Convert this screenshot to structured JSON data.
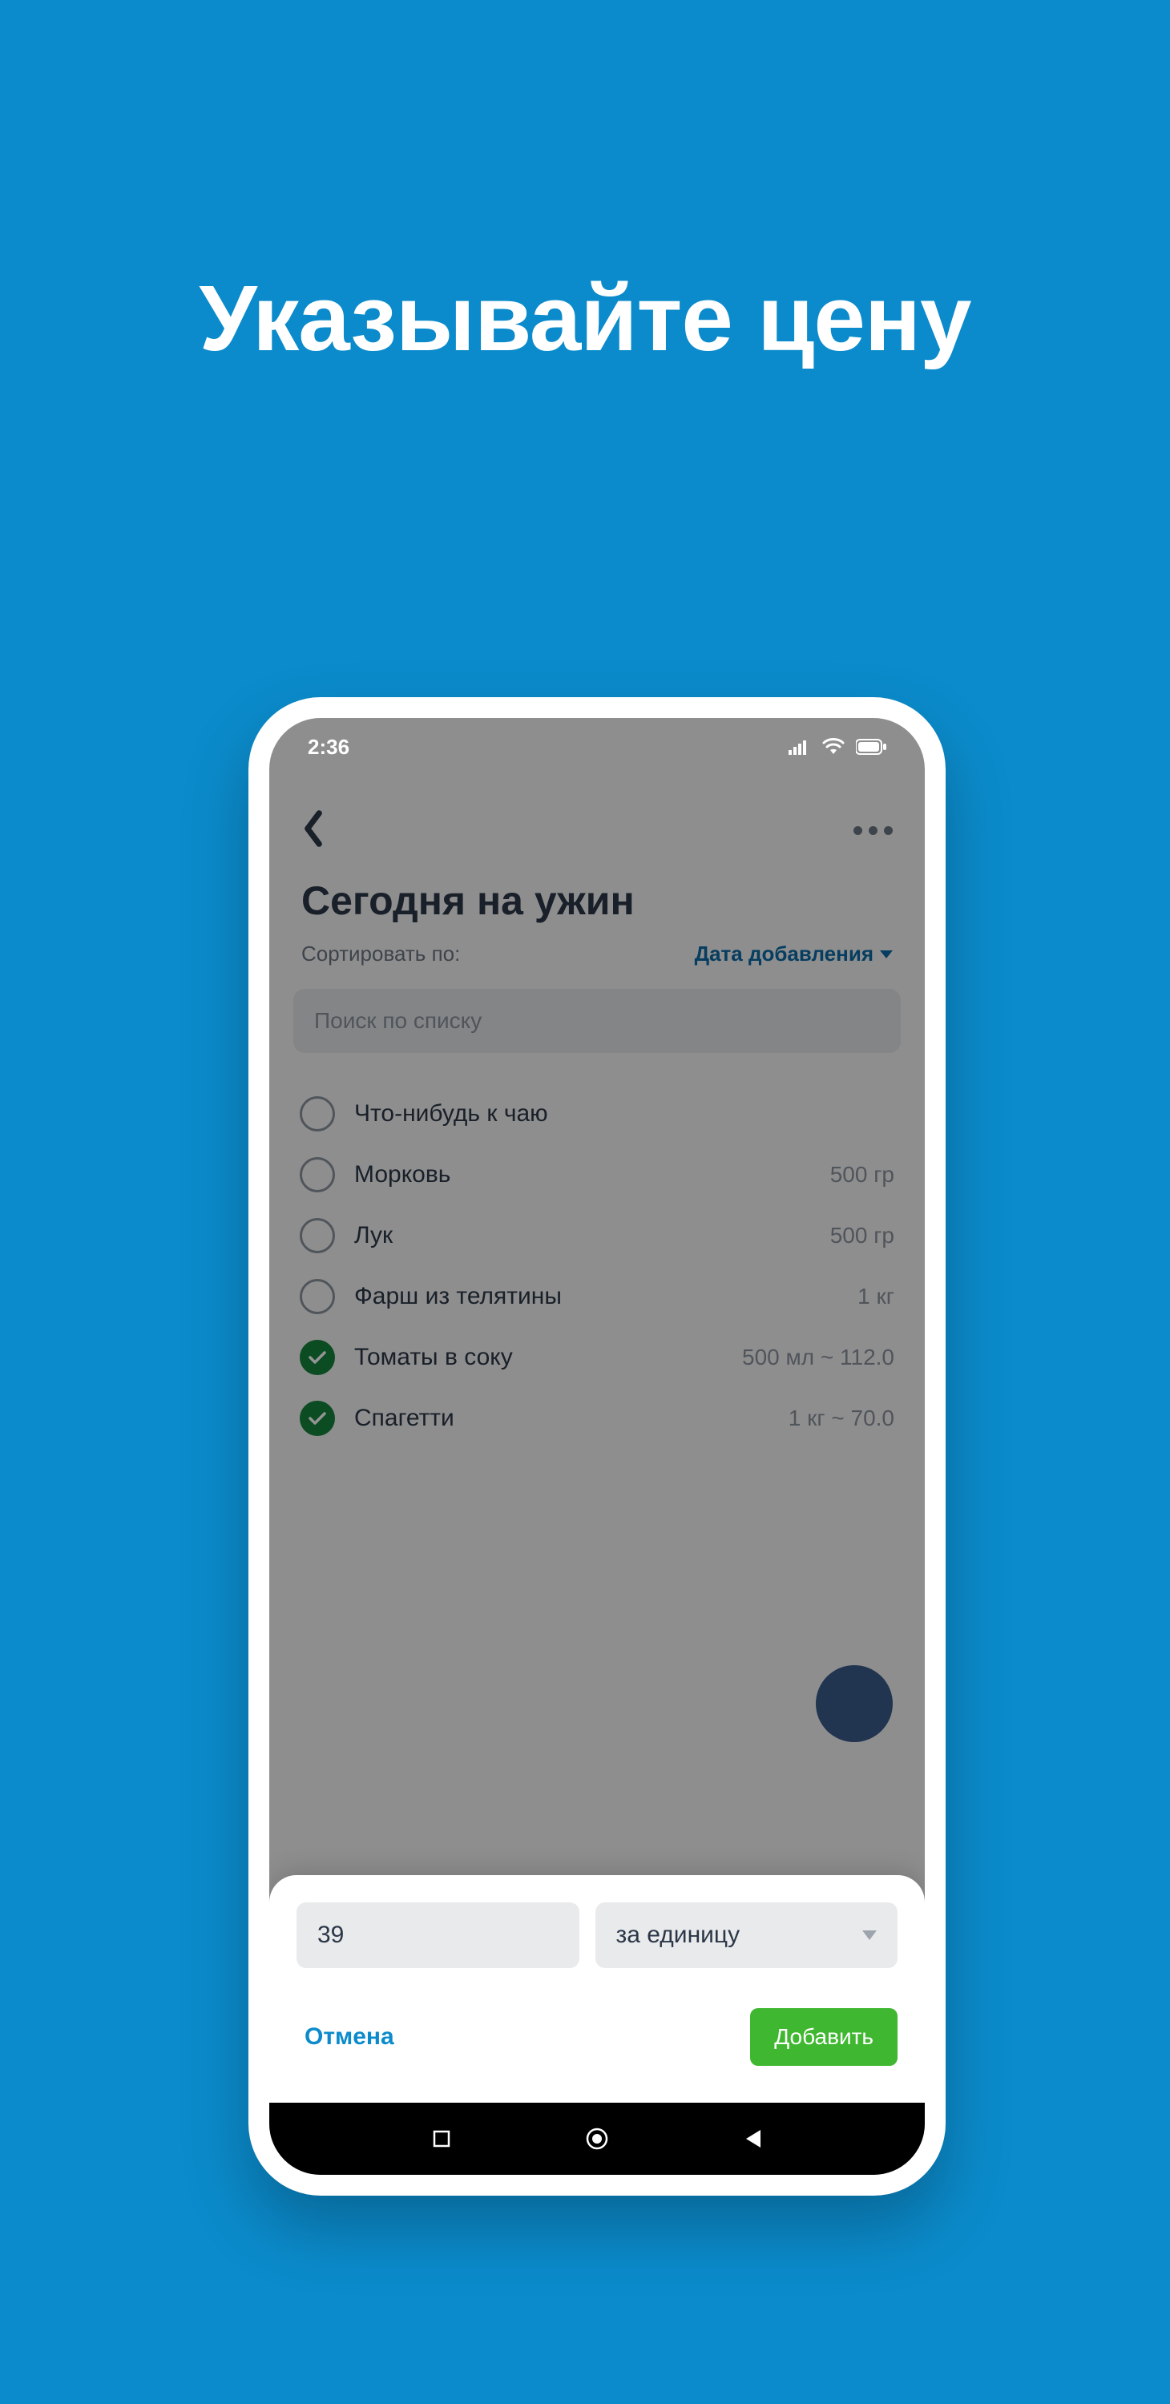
{
  "page": {
    "title": "Указывайте цену"
  },
  "status": {
    "time": "2:36"
  },
  "header": {
    "list_title": "Сегодня на ужин"
  },
  "sort": {
    "label": "Сортировать по:",
    "value": "Дата добавления"
  },
  "search": {
    "placeholder": "Поиск по списку"
  },
  "items": [
    {
      "name": "Что-нибудь к чаю",
      "qty": "",
      "done": false
    },
    {
      "name": "Морковь",
      "qty": "500 гр",
      "done": false
    },
    {
      "name": "Лук",
      "qty": "500 гр",
      "done": false
    },
    {
      "name": "Фарш из телятины",
      "qty": "1 кг",
      "done": false
    },
    {
      "name": "Томаты в соку",
      "qty": "500 мл ~ 112.0",
      "done": true
    },
    {
      "name": "Спагетти",
      "qty": "1 кг ~ 70.0",
      "done": true
    }
  ],
  "sheet": {
    "price_value": "39",
    "unit_value": "за единицу",
    "cancel": "Отмена",
    "add": "Добавить"
  }
}
